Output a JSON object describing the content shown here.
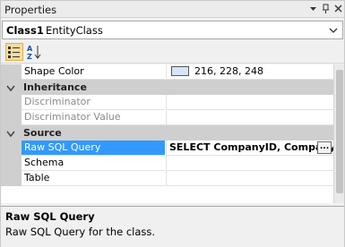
{
  "titlebar": {
    "title": "Properties"
  },
  "selector": {
    "object_name": "Class1",
    "object_type": "EntityClass"
  },
  "grid": {
    "shape_color": {
      "label": "Shape Color",
      "value": "216, 228, 248",
      "swatch_color": "#d8e4f8"
    },
    "inheritance": {
      "category": "Inheritance",
      "discriminator": {
        "label": "Discriminator",
        "value": ""
      },
      "discriminator_value": {
        "label": "Discriminator Value",
        "value": ""
      }
    },
    "source": {
      "category": "Source",
      "raw_sql_query": {
        "label": "Raw SQL Query",
        "value": "SELECT CompanyID, CompanyName",
        "button": "..."
      },
      "schema": {
        "label": "Schema",
        "value": ""
      },
      "table": {
        "label": "Table",
        "value": ""
      }
    }
  },
  "description": {
    "title": "Raw SQL Query",
    "text": "Raw SQL Query for the class."
  },
  "colors": {
    "selection": "#3399ff",
    "category_bg": "#cfcfcf",
    "toolbar_active": "#f6dca0"
  }
}
